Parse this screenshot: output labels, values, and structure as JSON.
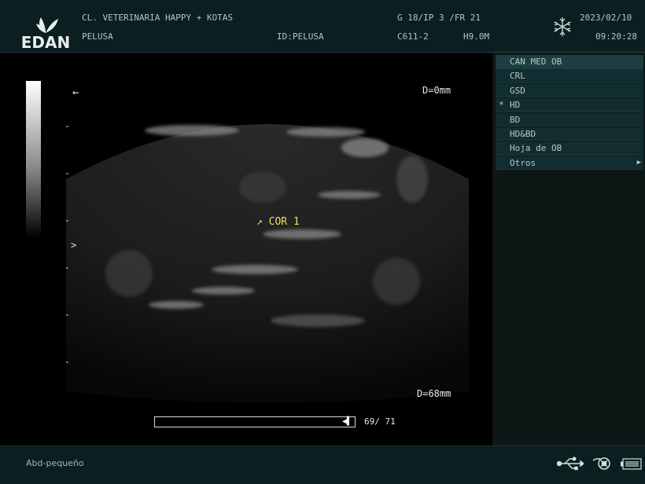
{
  "header": {
    "logo_text": "EDAN",
    "clinic": "CL. VETERINARIA HAPPY + KOTAS",
    "patient": "PELUSA",
    "patient_id": "ID:PELUSA",
    "gain": "G 18/IP 3 /FR 21",
    "probe": "C611-2",
    "frequency": "H9.0M",
    "date": "2023/02/10",
    "time": "09:20:28",
    "freeze_icon": "snowflake-icon"
  },
  "image": {
    "depth_top": "D=0mm",
    "depth_bottom": "D=68mm",
    "annotation": "COR 1",
    "focus_marker": ">",
    "orientation_marker": "←",
    "cine_counter": "69/ 71",
    "cine_progress": 0.97
  },
  "menu": {
    "items": [
      {
        "label": "CAN MED OB",
        "mark": "",
        "arrow": "",
        "header": true
      },
      {
        "label": "CRL",
        "mark": "",
        "arrow": ""
      },
      {
        "label": "GSD",
        "mark": "",
        "arrow": ""
      },
      {
        "label": "HD",
        "mark": "*",
        "arrow": ""
      },
      {
        "label": "BD",
        "mark": "",
        "arrow": ""
      },
      {
        "label": "HD&BD",
        "mark": "",
        "arrow": ""
      },
      {
        "label": "Hoja de OB",
        "mark": "",
        "arrow": ""
      },
      {
        "label": "Otros",
        "mark": "",
        "arrow": "▶"
      }
    ]
  },
  "footer": {
    "preset": "Abd-pequeño"
  },
  "colors": {
    "bar_bg": "#0b1e20",
    "menu_bg": "#122d30",
    "annotation": "#e8e060"
  }
}
